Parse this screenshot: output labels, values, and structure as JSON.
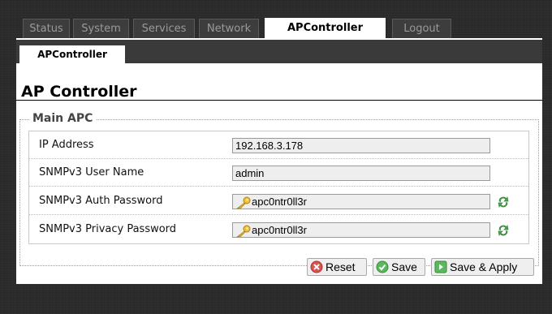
{
  "topnav": {
    "tabs": [
      {
        "label": "Status"
      },
      {
        "label": "System"
      },
      {
        "label": "Services"
      },
      {
        "label": "Network"
      },
      {
        "label": "APController",
        "active": true
      },
      {
        "label": "Logout"
      }
    ]
  },
  "subnav": {
    "active_label": "APController"
  },
  "page": {
    "title": "AP Controller",
    "section_title": "Main APC"
  },
  "fields": {
    "ip": {
      "label": "IP Address",
      "value": "192.168.3.178"
    },
    "user": {
      "label": "SNMPv3 User Name",
      "value": "admin"
    },
    "auth": {
      "label": "SNMPv3 Auth Password",
      "value": "apc0ntr0ll3r"
    },
    "priv": {
      "label": "SNMPv3 Privacy Password",
      "value": "apc0ntr0ll3r"
    }
  },
  "actions": {
    "reset": "Reset",
    "save": "Save",
    "apply": "Save & Apply"
  },
  "colors": {
    "active_tab": "#ffffff",
    "inactive_tab": "#3d3d3d",
    "reset_icon": "#d9534f",
    "save_icon": "#5cb85c"
  },
  "icons": [
    "key-icon",
    "reveal-password-icon",
    "reset-icon",
    "save-icon",
    "apply-icon"
  ]
}
